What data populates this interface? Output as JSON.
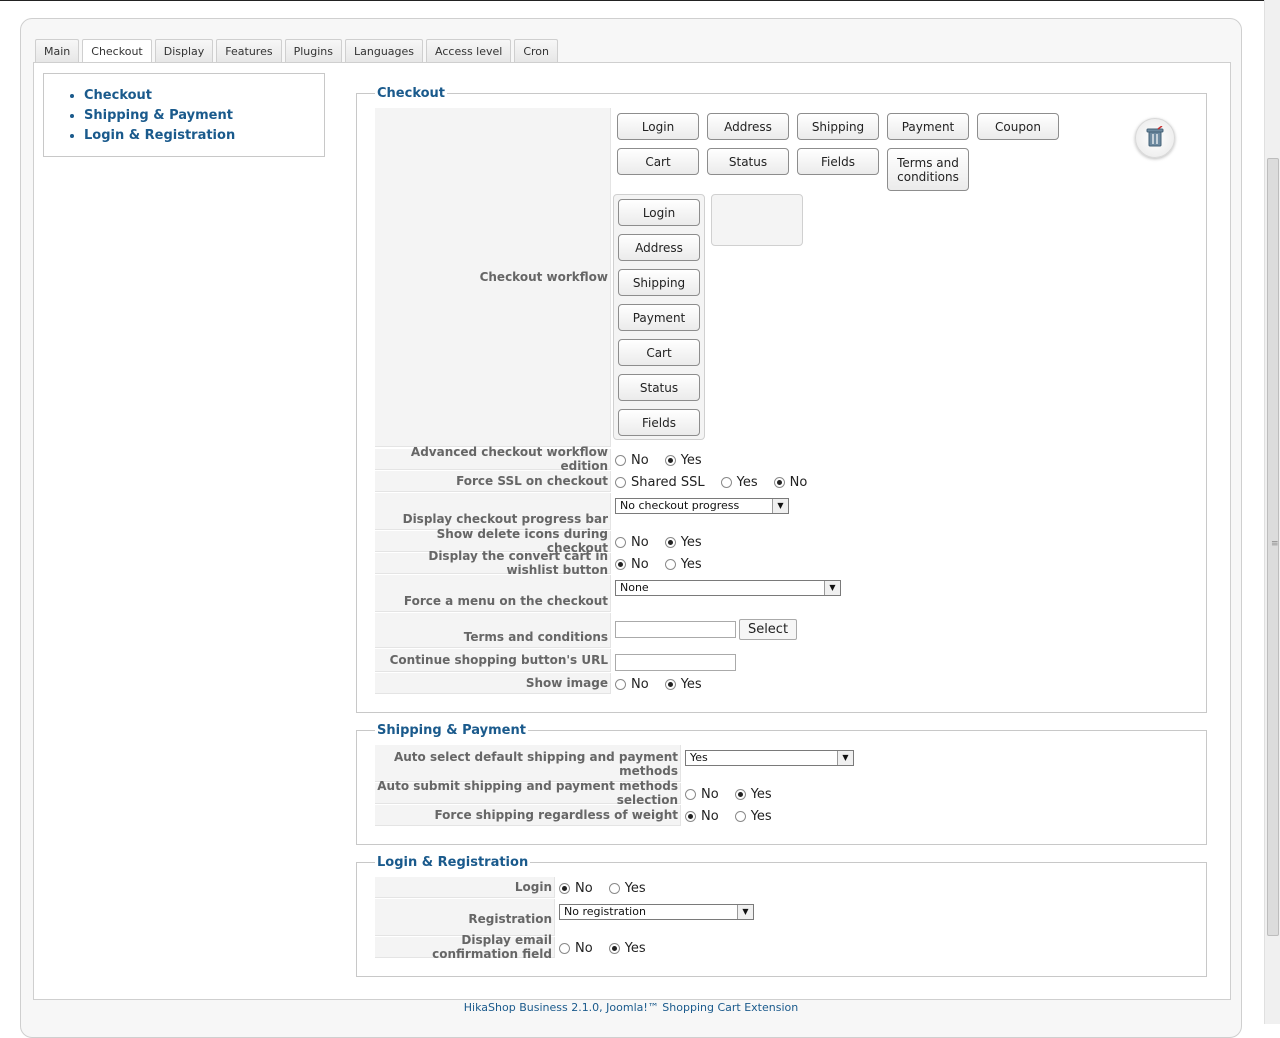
{
  "tabs": [
    "Main",
    "Checkout",
    "Display",
    "Features",
    "Plugins",
    "Languages",
    "Access level",
    "Cron"
  ],
  "active_tab": "Checkout",
  "leftnav": [
    "Checkout",
    "Shipping & Payment",
    "Login & Registration"
  ],
  "checkout": {
    "legend": "Checkout",
    "workflow_label": "Checkout workflow",
    "available_buttons_row1": [
      "Login",
      "Address",
      "Shipping",
      "Payment",
      "Coupon"
    ],
    "available_buttons_row2": [
      "Cart",
      "Status",
      "Fields",
      "Terms and conditions"
    ],
    "workflow_steps": [
      "Login",
      "Address",
      "Shipping",
      "Payment",
      "Cart",
      "Status",
      "Fields"
    ],
    "advanced_label": "Advanced checkout workflow edition",
    "advanced_opts": [
      "No",
      "Yes"
    ],
    "advanced_selected": "Yes",
    "ssl_label": "Force SSL on checkout",
    "ssl_opts": [
      "Shared SSL",
      "Yes",
      "No"
    ],
    "ssl_selected": "No",
    "progress_label": "Display checkout progress bar",
    "progress_value": "No checkout progress",
    "delete_icons_label": "Show delete icons during checkout",
    "delete_icons_opts": [
      "No",
      "Yes"
    ],
    "delete_icons_selected": "Yes",
    "convert_label": "Display the convert cart in wishlist button",
    "convert_opts": [
      "No",
      "Yes"
    ],
    "convert_selected": "No",
    "menu_label": "Force a menu on the checkout",
    "menu_value": "None",
    "terms_label": "Terms and conditions",
    "terms_value": "",
    "terms_button": "Select",
    "continue_label": "Continue shopping button's URL",
    "continue_value": "",
    "show_image_label": "Show image",
    "show_image_opts": [
      "No",
      "Yes"
    ],
    "show_image_selected": "Yes"
  },
  "shipping": {
    "legend": "Shipping & Payment",
    "autoselect_label": "Auto select default shipping and payment methods",
    "autoselect_value": "Yes",
    "autosubmit_label": "Auto submit shipping and payment methods selection",
    "autosubmit_opts": [
      "No",
      "Yes"
    ],
    "autosubmit_selected": "Yes",
    "force_label": "Force shipping regardless of weight",
    "force_opts": [
      "No",
      "Yes"
    ],
    "force_selected": "No"
  },
  "login": {
    "legend": "Login & Registration",
    "login_label": "Login",
    "login_opts": [
      "No",
      "Yes"
    ],
    "login_selected": "No",
    "registration_label": "Registration",
    "registration_value": "No registration",
    "email_label": "Display email confirmation field",
    "email_opts": [
      "No",
      "Yes"
    ],
    "email_selected": "Yes"
  },
  "footer": "HikaShop Business 2.1.0, Joomla!™ Shopping Cart Extension",
  "icons": {
    "trash": "trash-icon",
    "dropdown": "chevron-down-icon"
  }
}
